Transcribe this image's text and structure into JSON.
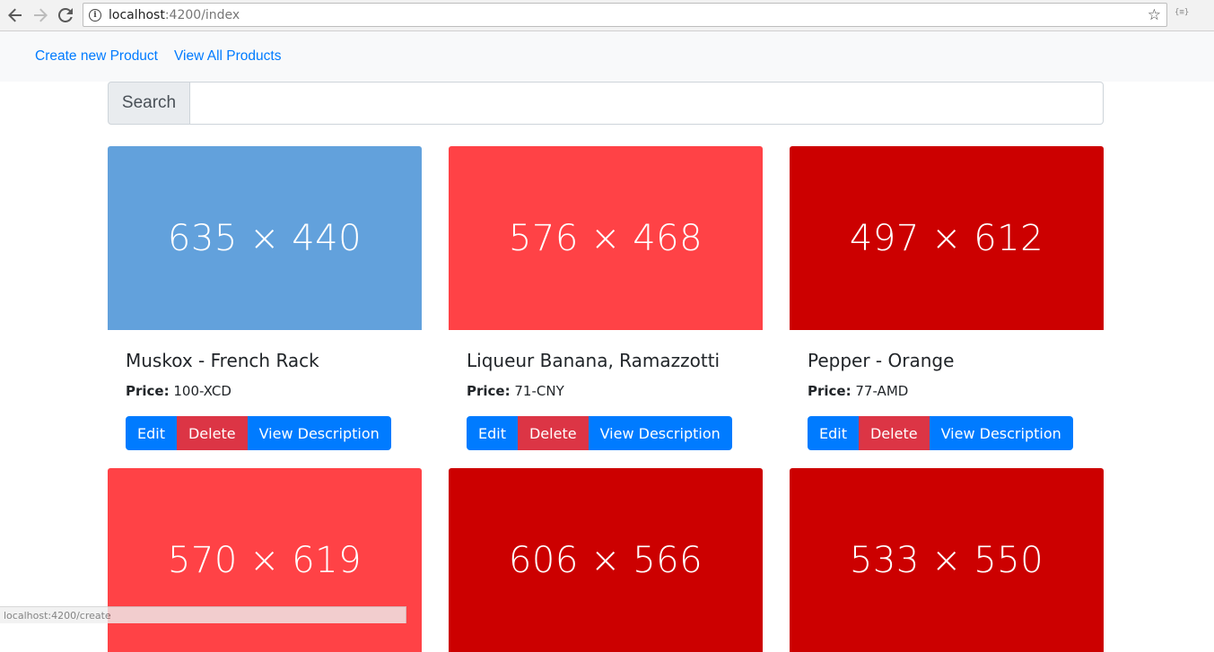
{
  "browser": {
    "url_host": "localhost",
    "url_path": ":4200/index",
    "back_icon": "arrow-left-icon",
    "forward_icon": "arrow-right-icon",
    "reload_icon": "reload-icon",
    "info_icon": "info-icon",
    "star_icon": "star-icon",
    "extension_label": "{≡}"
  },
  "navbar": {
    "links": [
      {
        "label": "Create new Product"
      },
      {
        "label": "View All Products"
      }
    ]
  },
  "search": {
    "label": "Search",
    "value": "",
    "placeholder": ""
  },
  "products": [
    {
      "image_label": "635 × 440",
      "image_color": "#62a1dc",
      "name": "Muskox - French Rack",
      "price_label": "Price:",
      "price": "100-XCD"
    },
    {
      "image_label": "576 × 468",
      "image_color": "#ff4246",
      "name": "Liqueur Banana, Ramazzotti",
      "price_label": "Price:",
      "price": "71-CNY"
    },
    {
      "image_label": "497 × 612",
      "image_color": "#cc0000",
      "name": "Pepper - Orange",
      "price_label": "Price:",
      "price": "77-AMD"
    },
    {
      "image_label": "570 × 619",
      "image_color": "#ff4246"
    },
    {
      "image_label": "606 × 566",
      "image_color": "#cc0000"
    },
    {
      "image_label": "533 × 550",
      "image_color": "#cc0000"
    }
  ],
  "buttons": {
    "edit": "Edit",
    "delete": "Delete",
    "view": "View Description"
  },
  "colors": {
    "primary": "#007bff",
    "danger": "#dc3545"
  },
  "statusbar": {
    "text": "localhost:4200/create"
  }
}
